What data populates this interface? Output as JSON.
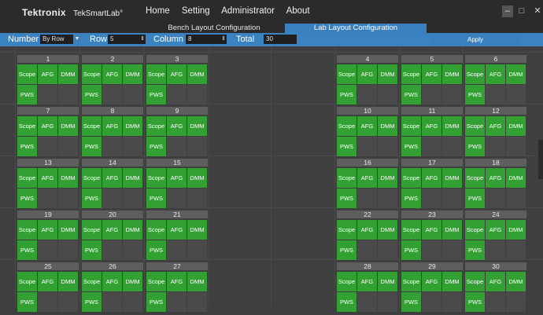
{
  "brand": {
    "name": "Tektronix",
    "product": "TekSmartLab°"
  },
  "menu": [
    "Home",
    "Setting",
    "Administrator",
    "About"
  ],
  "window_controls": [
    "–",
    "□",
    "✕"
  ],
  "tabs": [
    {
      "label": "Bench Layout Configuration",
      "active": false
    },
    {
      "label": "Lab Layout Configuration",
      "active": true
    }
  ],
  "toolbar": {
    "number_label": "Number",
    "number_value": "By Row",
    "row_label": "Row",
    "row_value": "5",
    "column_label": "Column",
    "column_value": "8",
    "total_label": "Total",
    "total_value": "30",
    "apply_label": "Apply"
  },
  "instruments": [
    "Scope",
    "AFG",
    "DMM",
    "PWS"
  ],
  "stations": [
    "1",
    "2",
    "3",
    "4",
    "5",
    "6",
    "7",
    "8",
    "9",
    "10",
    "11",
    "12",
    "13",
    "14",
    "15",
    "16",
    "17",
    "18",
    "19",
    "20",
    "21",
    "22",
    "23",
    "24",
    "25",
    "26",
    "27",
    "28",
    "29",
    "30"
  ],
  "colors": {
    "accent": "#3a82c0",
    "instrument": "#33a034",
    "background": "#3e3e3e",
    "titlebar": "#2b2b2b"
  }
}
